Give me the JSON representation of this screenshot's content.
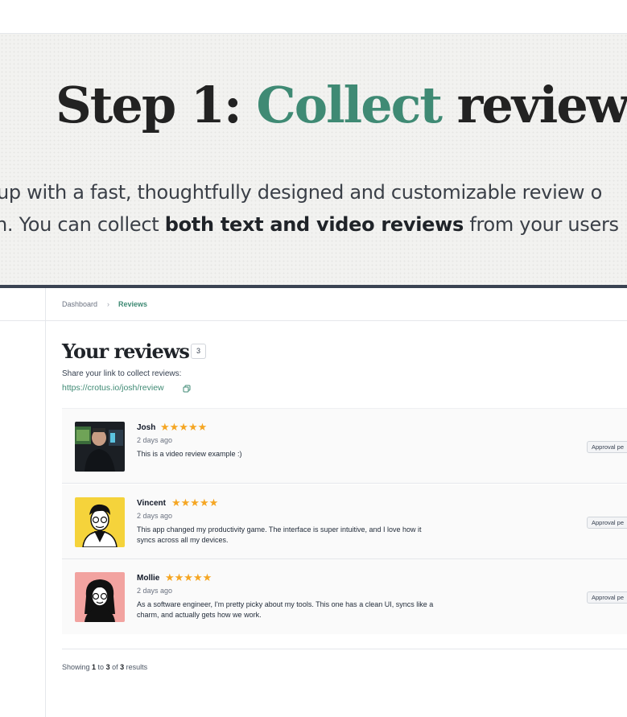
{
  "hero": {
    "title_prefix": "Step 1: ",
    "title_accent": "Collect",
    "title_suffix": " reviews",
    "line1": "up with a fast, thoughtfully designed and customizable review o",
    "line2_before": "n. You can collect ",
    "line2_bold": "both text and video reviews",
    "line2_after": " from your users",
    "accent_color": "#3f8a74"
  },
  "breadcrumb": {
    "items": [
      "Dashboard",
      "Reviews"
    ],
    "separator": "›"
  },
  "page": {
    "title": "Your reviews",
    "count": "3",
    "share_label": "Share your link to collect reviews:",
    "share_link": "https://crotus.io/josh/review"
  },
  "reviews": [
    {
      "name": "Josh",
      "rating": 5,
      "stars": "★★★★★",
      "date": "2 days ago",
      "text": "This is a video review example :)",
      "status": "Approval pe",
      "avatar": "video-thumbnail"
    },
    {
      "name": "Vincent",
      "rating": 5,
      "stars": "★★★★★",
      "date": "2 days ago",
      "text": "This app changed my productivity game. The interface is super intuitive, and I love how it syncs across all my devices.",
      "status": "Approval pe",
      "avatar": "illustrated-man-yellow"
    },
    {
      "name": "Mollie",
      "rating": 5,
      "stars": "★★★★★",
      "date": "2 days ago",
      "text": "As a software engineer, I'm pretty picky about my tools. This one has a clean UI, syncs like a charm, and actually gets how we work.",
      "status": "Approval pe",
      "avatar": "illustrated-woman-pink"
    }
  ],
  "pagination": {
    "prefix": "Showing ",
    "from": "1",
    "mid1": " to ",
    "to": "3",
    "mid2": " of ",
    "total": "3",
    "suffix": " results"
  },
  "colors": {
    "star": "#f5a623",
    "link": "#3f8a74",
    "app_border": "#3a4352"
  }
}
